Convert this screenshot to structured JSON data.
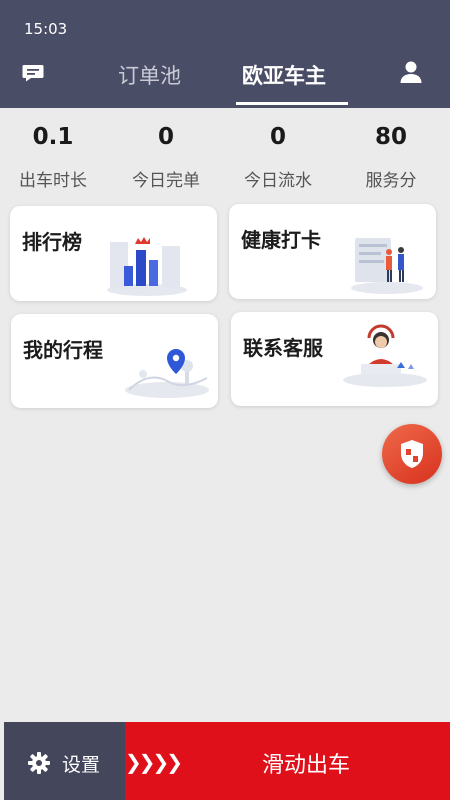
{
  "status_bar": {
    "time": "15:03"
  },
  "header": {
    "tabs": [
      {
        "label": "订单池",
        "active": false
      },
      {
        "label": "欧亚车主",
        "active": true
      }
    ],
    "message_icon": "chat-bubble-icon",
    "user_icon": "user-icon"
  },
  "stats": [
    {
      "value": "0.1",
      "label": "出车时长"
    },
    {
      "value": "0",
      "label": "今日完单"
    },
    {
      "value": "0",
      "label": "今日流水"
    },
    {
      "value": "80",
      "label": "服务分"
    }
  ],
  "cards": [
    {
      "title": "排行榜",
      "icon": "ranking-bars-icon"
    },
    {
      "title": "健康打卡",
      "icon": "health-checkin-icon"
    },
    {
      "title": "我的行程",
      "icon": "map-pin-icon"
    },
    {
      "title": "联系客服",
      "icon": "customer-service-icon"
    }
  ],
  "floating": {
    "icon": "shield-icon"
  },
  "bottom": {
    "settings_label": "设置",
    "slide_arrows": "❯❯❯❯",
    "slide_label": "滑动出车"
  },
  "colors": {
    "header_bg": "#4a4d66",
    "accent_red": "#e0101b",
    "settings_bg": "#44465c",
    "page_bg": "#ebebeb"
  }
}
